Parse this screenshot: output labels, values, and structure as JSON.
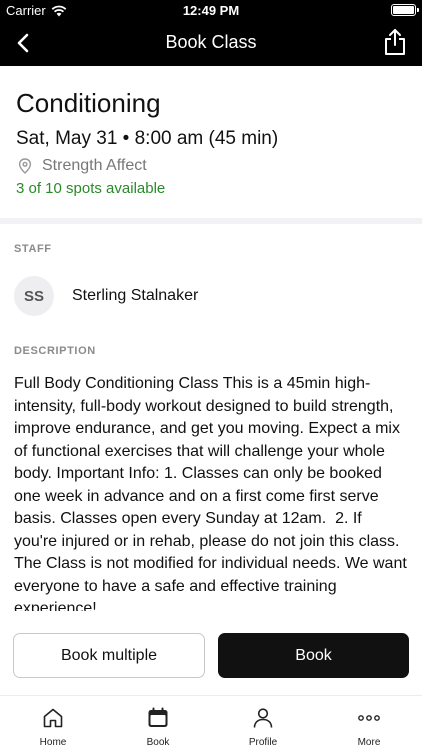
{
  "status_bar": {
    "carrier": "Carrier",
    "time": "12:49 PM"
  },
  "nav": {
    "title": "Book Class"
  },
  "class_info": {
    "name": "Conditioning",
    "datetime": "Sat, May 31 • 8:00 am (45 min)",
    "location": "Strength Affect",
    "spots": "3 of 10 spots available"
  },
  "staff": {
    "label": "STAFF",
    "initials": "SS",
    "name": "Sterling Stalnaker"
  },
  "description": {
    "label": "DESCRIPTION",
    "text": "Full Body Conditioning Class This is a 45min high-intensity, full-body workout designed to build strength, improve endurance, and get you moving. Expect a mix of functional exercises that will challenge your whole body. Important Info: 1. Classes can only be booked one week in advance and on a first come first serve basis. Classes open every Sunday at 12am.  2. If you're injured or in rehab, please do not join this class. The Class is not modified for individual needs. We want everyone to have a safe and effective training experience!"
  },
  "actions": {
    "book_multiple": "Book multiple",
    "book": "Book"
  },
  "tabs": [
    {
      "label": "Home",
      "icon": "home-icon"
    },
    {
      "label": "Book",
      "icon": "calendar-icon"
    },
    {
      "label": "Profile",
      "icon": "person-icon"
    },
    {
      "label": "More",
      "icon": "more-dots-icon"
    }
  ],
  "colors": {
    "accent": "#111111",
    "spots_available": "#2a8a2a",
    "muted": "#8a8a8a"
  }
}
